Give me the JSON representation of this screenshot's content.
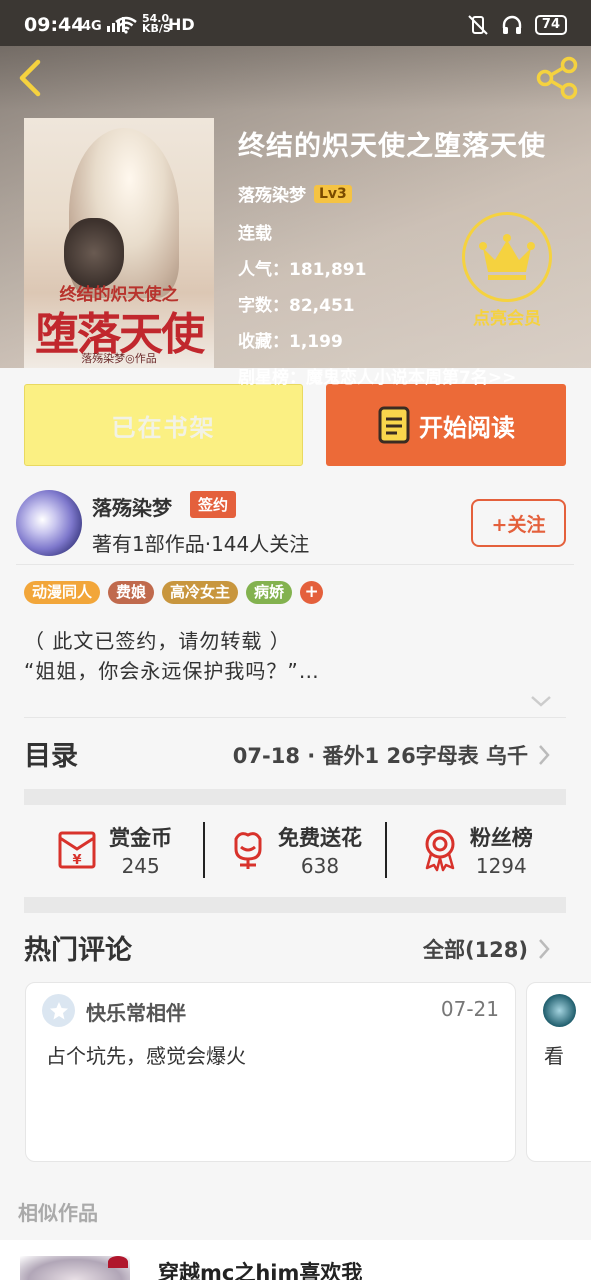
{
  "status_bar": {
    "time": "09:44",
    "network": "4G",
    "speed": "54.0\nKB/S",
    "hd": "HD",
    "battery": "74"
  },
  "book": {
    "title": "终结的炽天使之堕落天使",
    "author": "落殇染梦",
    "level": "Lv3",
    "status": "连载",
    "popularity": "人气：181,891",
    "word_count": "字数：82,451",
    "favorites": "收藏：1,199",
    "ranking": "剧星榜：魔鬼恋人小说本周第7名>>",
    "cover": {
      "subtitle": "终结的炽天使之",
      "main_title": "堕落天使",
      "author_credit": "落殇染梦◎作品"
    }
  },
  "vip": {
    "label": "点亮会员"
  },
  "actions": {
    "shelf_label": "已在书架",
    "read_label": "开始阅读"
  },
  "author_card": {
    "name": "落殇染梦",
    "signed_badge": "签约",
    "stats": "著有1部作品·144人关注",
    "follow_label": "+关注"
  },
  "tags": [
    {
      "label": "动漫同人",
      "color": "#f2a63a"
    },
    {
      "label": "费娘",
      "color": "#c06a4d"
    },
    {
      "label": "高冷女主",
      "color": "#c8963e"
    },
    {
      "label": "病娇",
      "color": "#83b24f"
    }
  ],
  "intro": {
    "line1": "（ 此文已签约，请勿转载 ）",
    "line2": "“姐姐，你会永远保护我吗？”…"
  },
  "toc": {
    "label": "目录",
    "latest": "07-18 · 番外1  26字母表  乌千"
  },
  "stats": [
    {
      "label": "赏金币",
      "value": "245",
      "icon": "red-envelope-icon"
    },
    {
      "label": "免费送花",
      "value": "638",
      "icon": "flower-icon"
    },
    {
      "label": "粉丝榜",
      "value": "1294",
      "icon": "medal-icon"
    }
  ],
  "comments": {
    "title": "热门评论",
    "all_label": "全部(128)",
    "items": [
      {
        "user": "快乐常相伴",
        "date": "07-21",
        "text": "占个坑先，感觉会爆火"
      },
      {
        "text": "看"
      }
    ]
  },
  "similar": {
    "title": "相似作品",
    "first_title": "穿越mc之him喜欢我"
  },
  "colors": {
    "accent_orange": "#ec6a38",
    "shelf_yellow": "#fbf083",
    "vip_gold": "#f5d23f",
    "signed_red": "#e4603c"
  }
}
